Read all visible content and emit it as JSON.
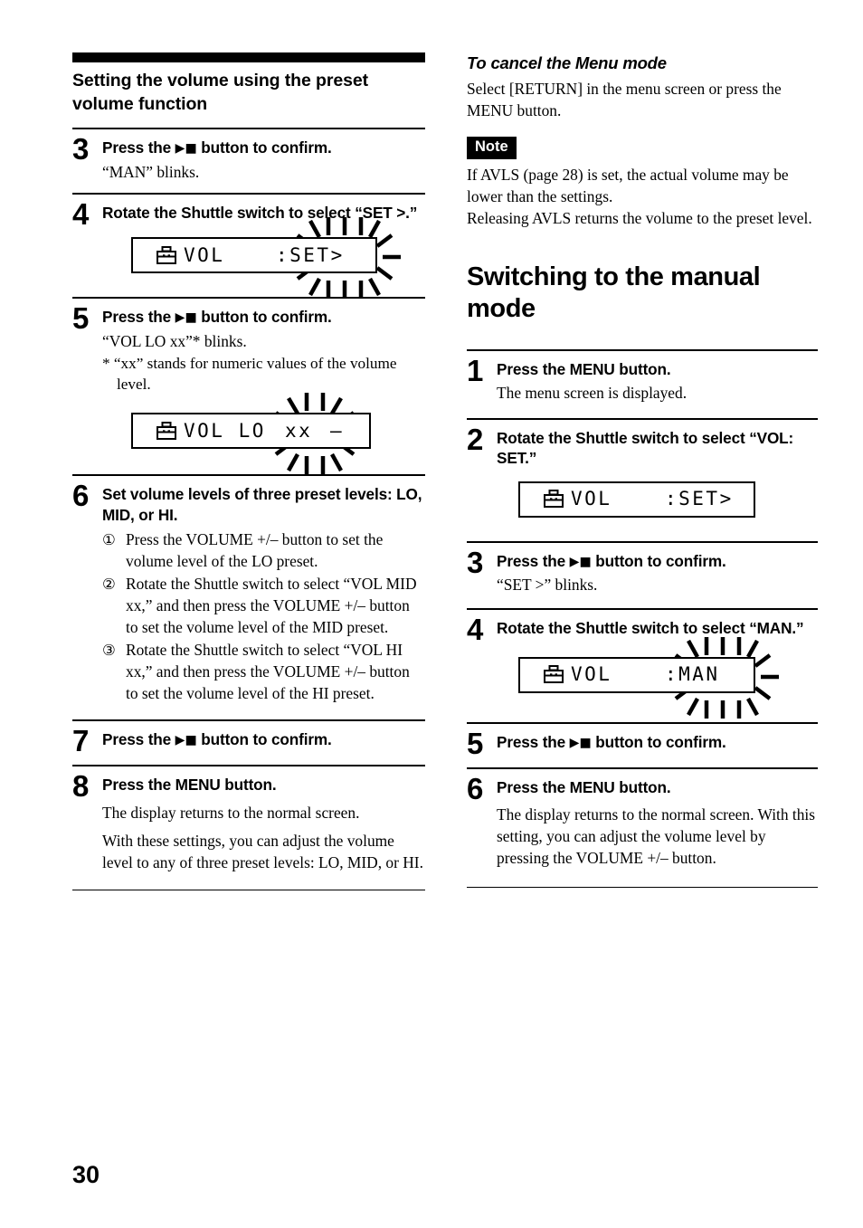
{
  "page": {
    "number": "30"
  },
  "left_column": {
    "section_title": "Setting the volume using the preset volume function",
    "steps": [
      {
        "num": "3",
        "head_pre": "Press the ",
        "head_icon": "▶■",
        "head_post": " button to confirm.",
        "sub": "“MAN” blinks."
      },
      {
        "num": "4",
        "head": "Rotate the Shuttle switch to select “SET >.”"
      },
      {
        "num": "5",
        "head_pre": "Press the ",
        "head_icon": "▶■",
        "head_post": " button to confirm.",
        "sub": "“VOL LO xx”* blinks.",
        "footnote": "* “xx” stands for numeric values of the volume level."
      },
      {
        "num": "6",
        "head": "Set volume levels of three preset levels: LO, MID, or HI.",
        "substeps": [
          {
            "marker": "①",
            "text": "Press the VOLUME +/– button to set the volume level of the LO preset."
          },
          {
            "marker": "②",
            "text": "Rotate the Shuttle switch to select “VOL MID xx,” and then press the VOLUME +/– button to set the volume level of the MID preset."
          },
          {
            "marker": "③",
            "text": "Rotate the Shuttle switch to select “VOL HI xx,” and then press the VOLUME +/– button to set the volume level of the HI preset."
          }
        ]
      },
      {
        "num": "7",
        "head_pre": "Press the ",
        "head_icon": "▶■",
        "head_post": " button to confirm."
      },
      {
        "num": "8",
        "head": "Press the MENU button.",
        "sub": "The display returns to the normal screen.",
        "sub2": "With these settings, you can adjust the volume level to any of three preset levels: LO, MID, or HI."
      }
    ],
    "lcd_set": {
      "icon": "toolbox-icon",
      "label": "VOL",
      "value": ":SET>",
      "blinking": "true"
    },
    "lcd_vol_lo": {
      "icon": "toolbox-icon",
      "label": "VOL LO",
      "value": "xx",
      "trailing": "–",
      "blinking": "true"
    }
  },
  "right_column": {
    "cancel_heading": "To cancel the Menu mode",
    "cancel_text": "Select [RETURN] in the menu screen or press the MENU button.",
    "note_label": "Note",
    "note_text_1": "If AVLS (page 28) is set, the actual volume may be lower than the settings.",
    "note_text_2": "Releasing AVLS returns the volume to the preset level.",
    "chapter_title": "Switching to the manual mode",
    "steps": [
      {
        "num": "1",
        "head": "Press the MENU button.",
        "sub": "The menu screen is displayed."
      },
      {
        "num": "2",
        "head": "Rotate the Shuttle switch to select “VOL: SET.”"
      },
      {
        "num": "3",
        "head_pre": "Press the ",
        "head_icon": "▶■",
        "head_post": " button to confirm.",
        "sub": "“SET >” blinks."
      },
      {
        "num": "4",
        "head": "Rotate the Shuttle switch to select “MAN.”"
      },
      {
        "num": "5",
        "head_pre": "Press the ",
        "head_icon": "▶■",
        "head_post": " button to confirm."
      },
      {
        "num": "6",
        "head": "Press the MENU button.",
        "sub": "The display returns to the normal screen. With this setting, you can adjust the volume level by pressing the VOLUME +/– button."
      }
    ],
    "lcd_vol_set": {
      "icon": "toolbox-icon",
      "label": "VOL",
      "value": ":SET>",
      "blinking": "false"
    },
    "lcd_vol_man": {
      "icon": "toolbox-icon",
      "label": "VOL",
      "value": ":MAN",
      "blinking": "true"
    }
  },
  "colors": {
    "ink": "#000000",
    "paper": "#ffffff"
  }
}
